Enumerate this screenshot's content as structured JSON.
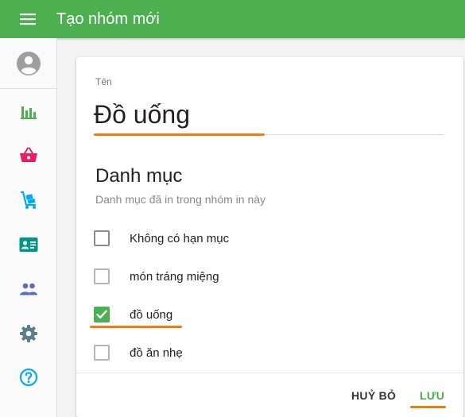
{
  "appbar": {
    "title": "Tạo nhóm mới",
    "menu_icon": "menu-icon"
  },
  "sidebar": {
    "items": [
      {
        "name": "account",
        "icon": "account-circle-icon",
        "color": "#9e9e9e"
      },
      {
        "name": "reports",
        "icon": "bar-chart-icon",
        "color": "#4caf50"
      },
      {
        "name": "sales",
        "icon": "shopping-basket-icon",
        "color": "#e91e63"
      },
      {
        "name": "inventory",
        "icon": "hand-truck-icon",
        "color": "#03a9f4"
      },
      {
        "name": "customers",
        "icon": "contact-card-icon",
        "color": "#009688"
      },
      {
        "name": "employees",
        "icon": "people-icon",
        "color": "#5c6bc0"
      },
      {
        "name": "settings",
        "icon": "gear-icon",
        "color": "#607d8b"
      },
      {
        "name": "help",
        "icon": "help-icon",
        "color": "#03a9f4"
      }
    ]
  },
  "form": {
    "name_label": "Tên",
    "name_value": "Đồ uống",
    "section_title": "Danh mục",
    "section_subtitle": "Danh mục đã in trong nhóm in này",
    "categories": [
      {
        "label": "Không có hạn mục",
        "checked": false
      },
      {
        "label": "món tráng miệng",
        "checked": false
      },
      {
        "label": "đồ uống",
        "checked": true
      },
      {
        "label": "đồ ăn nhẹ",
        "checked": false
      }
    ],
    "cancel_label": "HUỶ BỎ",
    "save_label": "LƯU"
  },
  "colors": {
    "primary": "#4caf50",
    "accent_highlight": "#ef7c0c"
  }
}
